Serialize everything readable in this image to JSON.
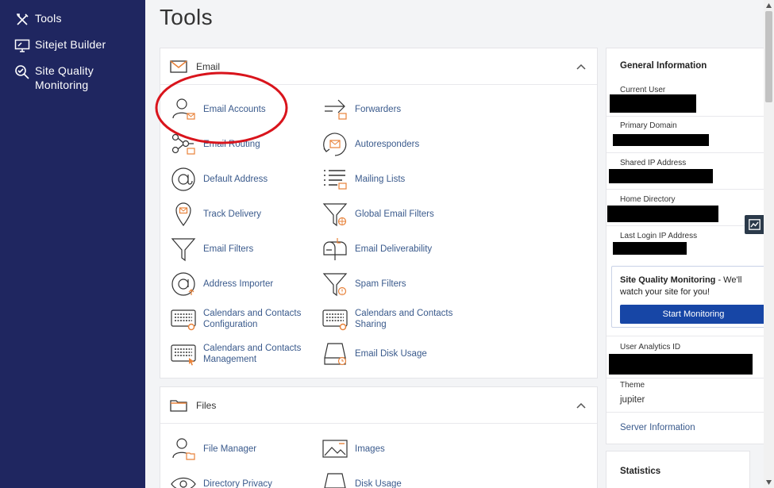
{
  "sidebar": {
    "items": [
      {
        "label": "Tools",
        "icon": "tools-icon"
      },
      {
        "label": "Sitejet Builder",
        "icon": "monitor-icon"
      },
      {
        "label": "Site Quality Monitoring",
        "icon": "magnifier-icon"
      }
    ]
  },
  "page": {
    "title": "Tools"
  },
  "email": {
    "title": "Email",
    "tools": [
      {
        "label": "Email Accounts",
        "icon": "user-mail-icon"
      },
      {
        "label": "Forwarders",
        "icon": "forward-arrow-icon"
      },
      {
        "label": "Email Routing",
        "icon": "routing-icon"
      },
      {
        "label": "Autoresponders",
        "icon": "autoresponder-icon"
      },
      {
        "label": "Default Address",
        "icon": "at-sign-icon"
      },
      {
        "label": "Mailing Lists",
        "icon": "list-icon"
      },
      {
        "label": "Track Delivery",
        "icon": "map-pin-icon"
      },
      {
        "label": "Global Email Filters",
        "icon": "filter-globe-icon"
      },
      {
        "label": "Email Filters",
        "icon": "filter-icon"
      },
      {
        "label": "Email Deliverability",
        "icon": "mailbox-icon"
      },
      {
        "label": "Address Importer",
        "icon": "at-import-icon"
      },
      {
        "label": "Spam Filters",
        "icon": "filter-alert-icon"
      },
      {
        "label": "Calendars and Contacts Configuration",
        "icon": "calendar-gear-icon"
      },
      {
        "label": "Calendars and Contacts Sharing",
        "icon": "calendar-share-icon"
      },
      {
        "label": "Calendars and Contacts Management",
        "icon": "calendar-pointer-icon"
      },
      {
        "label": "Email Disk Usage",
        "icon": "disk-clock-icon"
      }
    ]
  },
  "files": {
    "title": "Files",
    "tools": [
      {
        "label": "File Manager",
        "icon": "user-folder-icon"
      },
      {
        "label": "Images",
        "icon": "image-icon"
      },
      {
        "label": "Directory Privacy",
        "icon": "eye-icon"
      },
      {
        "label": "Disk Usage",
        "icon": "disk-icon"
      }
    ]
  },
  "general_info": {
    "title": "General Information",
    "current_user_label": "Current User",
    "primary_domain_label": "Primary Domain",
    "shared_ip_label": "Shared IP Address",
    "home_dir_label": "Home Directory",
    "last_login_label": "Last Login IP Address",
    "sqm_title": "Site Quality Monitoring",
    "sqm_text": " - We'll watch your site for you!",
    "sqm_button": "Start Monitoring",
    "analytics_label": "User Analytics ID",
    "theme_label": "Theme",
    "theme_value": "jupiter",
    "server_info_link": "Server Information"
  },
  "statistics": {
    "title": "Statistics"
  },
  "colors": {
    "sidebar_bg": "#1f2660",
    "link": "#3a5a8c",
    "accent_orange": "#e8823a",
    "button_blue": "#1746a6",
    "annotation_red": "#d9141c"
  }
}
